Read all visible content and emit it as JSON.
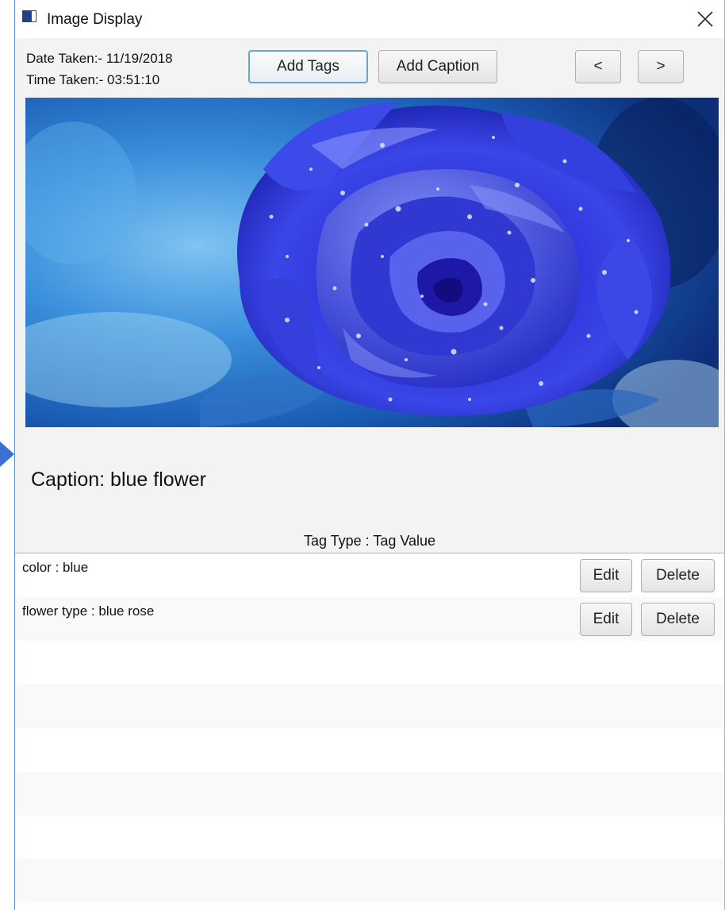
{
  "window": {
    "title": "Image Display"
  },
  "meta": {
    "date_taken": "Date Taken:- 11/19/2018",
    "time_taken": "Time Taken:- 03:51:10"
  },
  "toolbar": {
    "add_tags_label": "Add Tags",
    "add_caption_label": "Add Caption",
    "prev_label": "<",
    "next_label": ">"
  },
  "image": {
    "subject": "blue rose with water droplets",
    "dominant_color": "#2a2fd6"
  },
  "caption": {
    "text": "Caption: blue flower"
  },
  "tags_table": {
    "header": "Tag Type : Tag Value",
    "rows": [
      {
        "text": "color : blue",
        "edit_label": "Edit",
        "delete_label": "Delete"
      },
      {
        "text": "flower type : blue rose",
        "edit_label": "Edit",
        "delete_label": "Delete"
      }
    ]
  },
  "colors": {
    "accent_focus": "#5fa7de",
    "window_border": "#5b8fd6",
    "background": "#f3f3f3"
  }
}
